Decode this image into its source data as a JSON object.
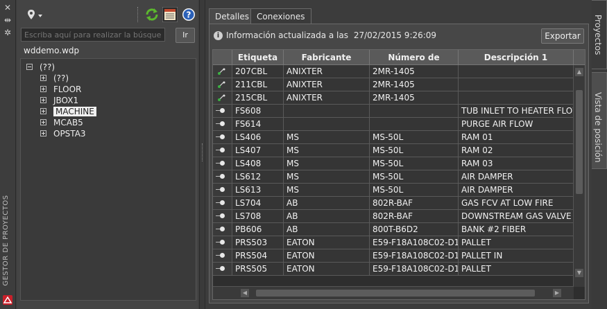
{
  "sidebar": {
    "vertical_title": "GESTOR DE PROYECTOS"
  },
  "left_panel": {
    "search": {
      "placeholder": "Escriba aquí para realizar la búsqueda..."
    },
    "go_label": "Ir",
    "project_name": "wddemo.wdp",
    "tree": [
      {
        "label": "(??)",
        "expanded": true
      },
      {
        "label": "(??)",
        "expanded": false
      },
      {
        "label": "FLOOR",
        "expanded": false
      },
      {
        "label": "JBOX1",
        "expanded": false
      },
      {
        "label": "MACHINE",
        "expanded": false,
        "selected": true
      },
      {
        "label": "MCAB5",
        "expanded": false
      },
      {
        "label": "OPSTA3",
        "expanded": false
      }
    ]
  },
  "right_panel": {
    "tabs": [
      "Detalles",
      "Conexiones"
    ],
    "info_prefix": "Información actualizada a las",
    "info_timestamp": "27/02/2015 9:26:09",
    "export_label": "Exportar",
    "columns": [
      "Etiqueta",
      "Fabricante",
      "Número de catálogo",
      "Descripción 1"
    ],
    "rows": [
      {
        "icon": "link",
        "tag": "207CBL",
        "mfr": "ANIXTER",
        "cat": "2MR-1405",
        "desc": ""
      },
      {
        "icon": "link",
        "tag": "211CBL",
        "mfr": "ANIXTER",
        "cat": "2MR-1405",
        "desc": ""
      },
      {
        "icon": "link",
        "tag": "215CBL",
        "mfr": "ANIXTER",
        "cat": "2MR-1405",
        "desc": ""
      },
      {
        "icon": "device",
        "tag": "FS608",
        "mfr": "",
        "cat": "",
        "desc": "TUB INLET TO HEATER FLOW"
      },
      {
        "icon": "device",
        "tag": "FS614",
        "mfr": "",
        "cat": "",
        "desc": "PURGE AIR FLOW"
      },
      {
        "icon": "device",
        "tag": "LS406",
        "mfr": "MS",
        "cat": "MS-50L",
        "desc": "RAM 01"
      },
      {
        "icon": "device",
        "tag": "LS407",
        "mfr": "MS",
        "cat": "MS-50L",
        "desc": "RAM 02"
      },
      {
        "icon": "device",
        "tag": "LS408",
        "mfr": "MS",
        "cat": "MS-50L",
        "desc": "RAM 03"
      },
      {
        "icon": "device",
        "tag": "LS612",
        "mfr": "MS",
        "cat": "MS-50L",
        "desc": "AIR DAMPER"
      },
      {
        "icon": "device",
        "tag": "LS613",
        "mfr": "MS",
        "cat": "MS-50L",
        "desc": "AIR DAMPER"
      },
      {
        "icon": "device",
        "tag": "LS704",
        "mfr": "AB",
        "cat": "802R-BAF",
        "desc": "GAS FCV AT LOW FIRE"
      },
      {
        "icon": "device",
        "tag": "LS708",
        "mfr": "AB",
        "cat": "802R-BAF",
        "desc": "DOWNSTREAM GAS VALVE"
      },
      {
        "icon": "device",
        "tag": "PB606",
        "mfr": "AB",
        "cat": "800T-B6D2",
        "desc": "BANK #2 FIBER"
      },
      {
        "icon": "device",
        "tag": "PRS503",
        "mfr": "EATON",
        "cat": "E59-F18A108C02-D1",
        "desc": "PALLET"
      },
      {
        "icon": "device",
        "tag": "PRS504",
        "mfr": "EATON",
        "cat": "E59-F18A108C02-D1",
        "desc": "PALLET IN"
      },
      {
        "icon": "device",
        "tag": "PRS505",
        "mfr": "EATON",
        "cat": "E59-F18A108C02-D1",
        "desc": "PALLET"
      }
    ]
  },
  "side_tabs": [
    "Proyectos",
    "Vista de posición"
  ]
}
